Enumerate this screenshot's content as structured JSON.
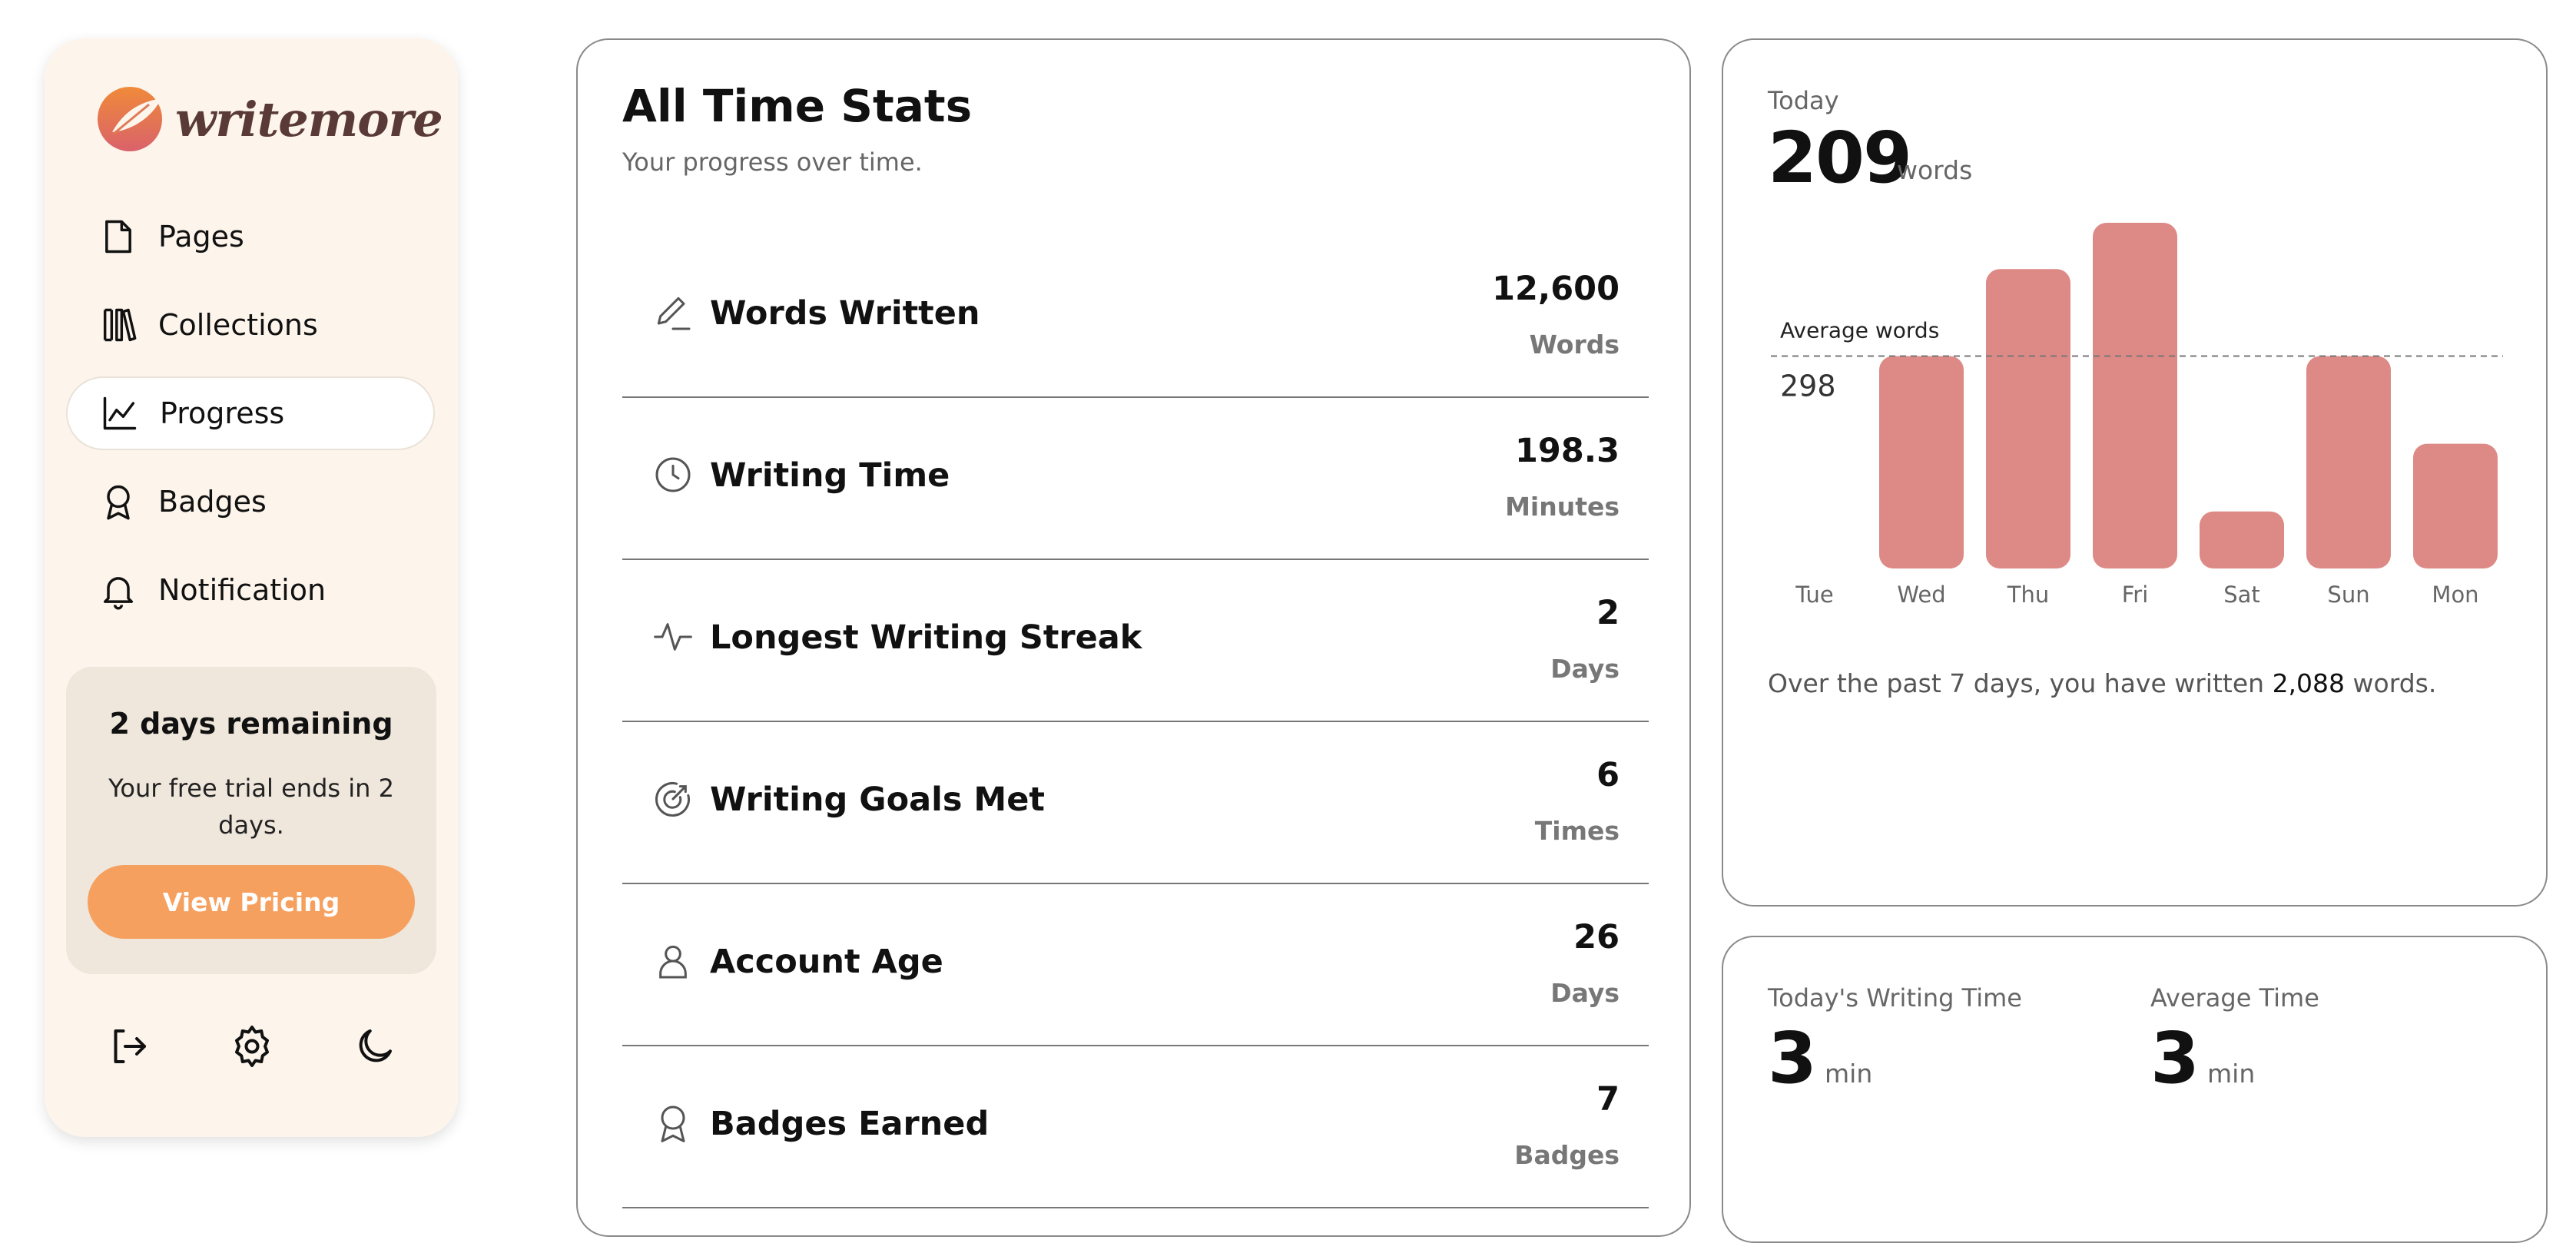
{
  "app": {
    "name": "writemore"
  },
  "sidebar": {
    "items": [
      {
        "label": "Pages",
        "icon": "page-icon",
        "active": false
      },
      {
        "label": "Collections",
        "icon": "books-icon",
        "active": false
      },
      {
        "label": "Progress",
        "icon": "chart-line-icon",
        "active": true
      },
      {
        "label": "Badges",
        "icon": "badge-icon",
        "active": false
      },
      {
        "label": "Notification",
        "icon": "bell-icon",
        "active": false
      }
    ],
    "trial": {
      "title": "2 days remaining",
      "text": "Your free trial ends in 2 days.",
      "button": "View Pricing"
    },
    "footer_icons": [
      "logout-icon",
      "settings-gear-icon",
      "moon-icon"
    ]
  },
  "stats": {
    "title": "All Time Stats",
    "subtitle": "Your progress over time.",
    "rows": [
      {
        "label": "Words Written",
        "value": "12,600",
        "unit": "Words",
        "icon": "pen-icon"
      },
      {
        "label": "Writing Time",
        "value": "198.3",
        "unit": "Minutes",
        "icon": "clock-icon"
      },
      {
        "label": "Longest Writing Streak",
        "value": "2",
        "unit": "Days",
        "icon": "pulse-icon"
      },
      {
        "label": "Writing Goals Met",
        "value": "6",
        "unit": "Times",
        "icon": "target-icon"
      },
      {
        "label": "Account Age",
        "value": "26",
        "unit": "Days",
        "icon": "user-icon"
      },
      {
        "label": "Badges Earned",
        "value": "7",
        "unit": "Badges",
        "icon": "badge-icon"
      }
    ]
  },
  "today": {
    "label": "Today",
    "count": "209",
    "unit": "words",
    "summary_prefix": "Over the past 7 days, you have written ",
    "summary_value": "2,088",
    "summary_suffix": " words."
  },
  "chart_data": {
    "type": "bar",
    "categories": [
      "Tue",
      "Wed",
      "Thu",
      "Fri",
      "Sat",
      "Sun",
      "Mon"
    ],
    "values": [
      0,
      298,
      420,
      485,
      80,
      298,
      175
    ],
    "average": {
      "label": "Average words",
      "value": 298
    },
    "bar_color": "#dd8a86",
    "grid": false
  },
  "time": {
    "today_label": "Today's Writing Time",
    "today_value": "3",
    "today_unit": "min",
    "avg_label": "Average Time",
    "avg_value": "3",
    "avg_unit": "min"
  },
  "colors": {
    "accent": "#f6a05f",
    "sidebar_bg": "#fdf5ec",
    "trial_bg": "#efe6dc",
    "bar": "#dd8a86"
  }
}
